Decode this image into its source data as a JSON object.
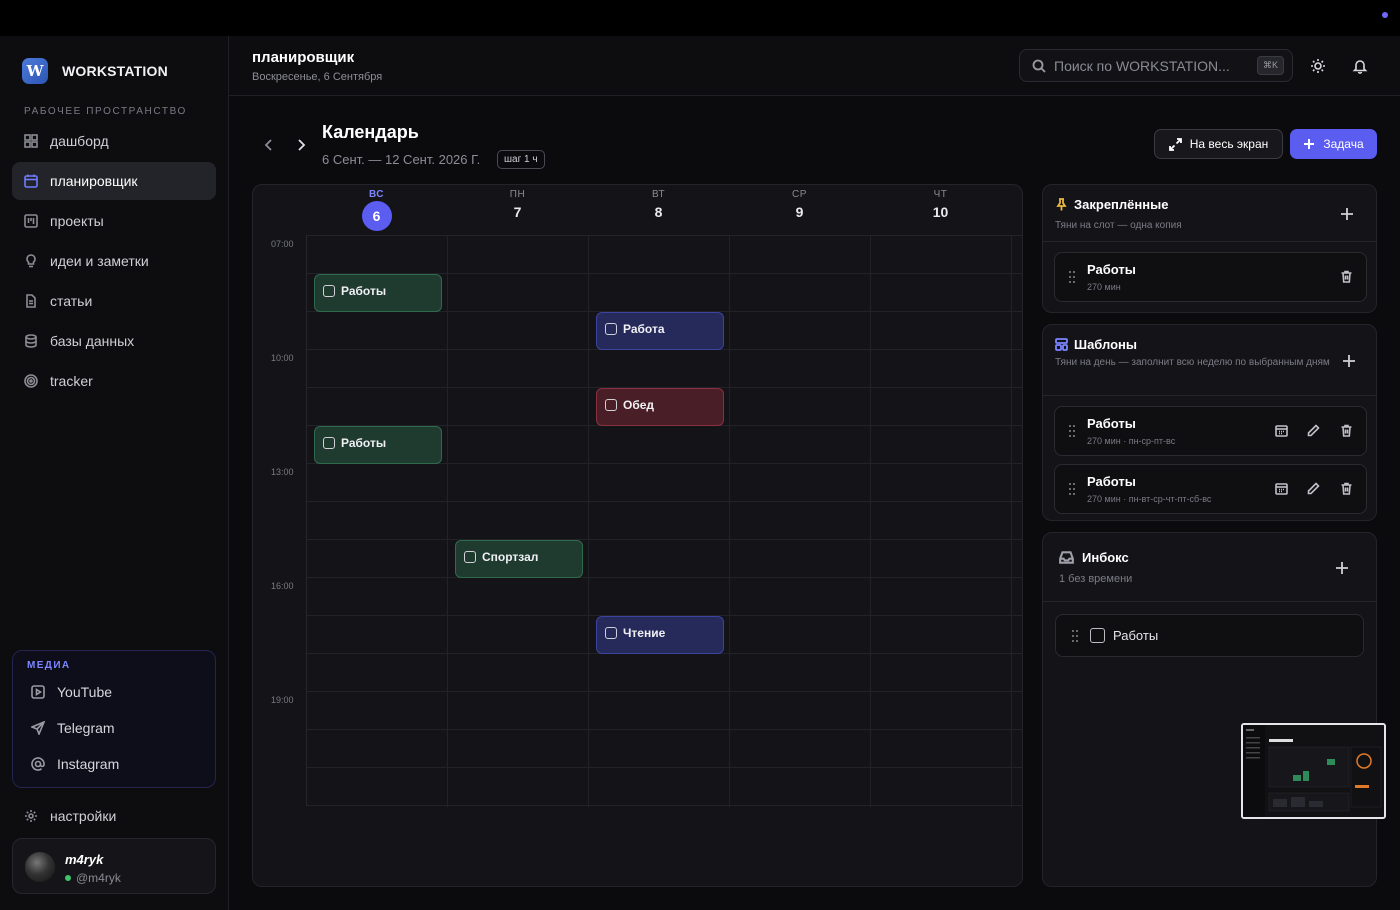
{
  "app": {
    "brand_letter": "W",
    "brand_name": "WORKSTATION",
    "accent_color": "#5b5cf0"
  },
  "sidebar": {
    "workspace_label": "РАБОЧЕЕ ПРОСТРАНСТВО",
    "items": [
      {
        "label": "дашборд",
        "icon": "grid-icon"
      },
      {
        "label": "планировщик",
        "icon": "calendar-icon",
        "active": true
      },
      {
        "label": "проекты",
        "icon": "kanban-icon"
      },
      {
        "label": "идеи и заметки",
        "icon": "lightbulb-icon"
      },
      {
        "label": "статьи",
        "icon": "document-icon"
      },
      {
        "label": "базы данных",
        "icon": "database-icon"
      },
      {
        "label": "tracker",
        "icon": "target-icon"
      }
    ],
    "media": {
      "label": "МЕДИА",
      "items": [
        {
          "label": "YouTube",
          "icon": "play-icon"
        },
        {
          "label": "Telegram",
          "icon": "send-icon"
        },
        {
          "label": "Instagram",
          "icon": "at-icon"
        }
      ]
    },
    "settings_label": "настройки",
    "user": {
      "name": "m4ryk",
      "handle": "@m4ryk"
    }
  },
  "header": {
    "title": "планировщик",
    "date": "Воскресенье, 6 Сентября",
    "search_placeholder": "Поиск по WORKSTATION...",
    "search_kbd": "⌘K"
  },
  "calendar": {
    "title": "Календарь",
    "range": "6 Сент. — 12 Сент. 2026 Г.",
    "step": "шаг 1 ч",
    "fullscreen_label": "На весь экран",
    "add_task_label": "Задача",
    "days": [
      {
        "weekday": "ВС",
        "num": "6",
        "today": true
      },
      {
        "weekday": "ПН",
        "num": "7"
      },
      {
        "weekday": "ВТ",
        "num": "8"
      },
      {
        "weekday": "СР",
        "num": "9"
      },
      {
        "weekday": "ЧТ",
        "num": "10"
      }
    ],
    "time_labels": [
      "07:00",
      "10:00",
      "13:00",
      "16:00",
      "19:00"
    ],
    "events": [
      {
        "title": "Работы",
        "day": 0,
        "slot": 1,
        "color": "green"
      },
      {
        "title": "Работа",
        "day": 2,
        "slot": 2,
        "color": "blue"
      },
      {
        "title": "Обед",
        "day": 2,
        "slot": 4,
        "color": "red"
      },
      {
        "title": "Работы",
        "day": 0,
        "slot": 5,
        "color": "green"
      },
      {
        "title": "Спортзал",
        "day": 1,
        "slot": 8,
        "color": "green"
      },
      {
        "title": "Чтение",
        "day": 2,
        "slot": 10,
        "color": "blue"
      }
    ]
  },
  "pinned": {
    "title": "Закреплённые",
    "subtitle": "Тяни на слот — одна копия",
    "items": [
      {
        "title": "Работы",
        "sub": "270 мин"
      }
    ]
  },
  "templates": {
    "title": "Шаблоны",
    "subtitle": "Тяни на день — заполнит всю неделю по выбранным дням",
    "items": [
      {
        "title": "Работы",
        "sub": "270 мин · пн-ср-пт-вс"
      },
      {
        "title": "Работы",
        "sub": "270 мин · пн-вт-ср-чт-пт-сб-вс"
      }
    ]
  },
  "inbox": {
    "title": "Инбокс",
    "subtitle": "1 без времени",
    "items": [
      {
        "title": "Работы"
      }
    ]
  }
}
